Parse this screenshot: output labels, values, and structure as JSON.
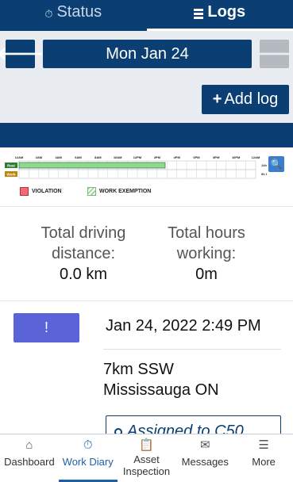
{
  "tabs": [
    {
      "label": "Status",
      "icon": "stopwatch-icon"
    },
    {
      "label": "Logs",
      "icon": "list-icon"
    }
  ],
  "date_nav": {
    "date_label": "Mon Jan 24",
    "prev_icon": "arrow-left-icon",
    "next_icon": "arrow-right-icon"
  },
  "add_log": {
    "label": "Add log",
    "icon": "plus-icon"
  },
  "graph": {
    "hours": [
      "12AM",
      "2AM",
      "4AM",
      "6AM",
      "8AM",
      "10AM",
      "12PM",
      "2PM",
      "4PM",
      "6PM",
      "8PM",
      "10PM",
      "12AM"
    ],
    "rows": [
      {
        "label": "Rest",
        "color": "#2e7d32"
      },
      {
        "label": "Work",
        "color": "#b8860b"
      }
    ],
    "rest_total": "14h 49m",
    "work_total": "0h 0m",
    "rest_segment_hours": [
      0,
      14.82
    ],
    "rest_fill": "#8fd88f",
    "legend": [
      {
        "label": "VIOLATION",
        "color": "#f06b7a"
      },
      {
        "label": "WORK EXEMPTION",
        "color": "#9bd69b"
      }
    ]
  },
  "totals": {
    "driving": {
      "label": "Total driving distance:",
      "value": "0.0 km"
    },
    "working": {
      "label": "Total hours working:",
      "value": "0m"
    }
  },
  "entry": {
    "badge": "!",
    "timestamp": "Jan 24, 2022 2:49 PM",
    "location_line1": "7km SSW",
    "location_line2": "Mississauga ON",
    "assigned": "Assigned to C50"
  },
  "bottom_nav": [
    {
      "label": "Dashboard",
      "icon": "home-icon"
    },
    {
      "label": "Work Diary",
      "icon": "stopwatch-icon"
    },
    {
      "label": "Asset Inspection",
      "icon": "clipboard-icon"
    },
    {
      "label": "Messages",
      "icon": "envelope-icon"
    },
    {
      "label": "More",
      "icon": "menu-icon"
    }
  ],
  "colors": {
    "primary": "#0b3f73",
    "badge": "#5b63d9",
    "active_nav": "#1f5fa8"
  }
}
